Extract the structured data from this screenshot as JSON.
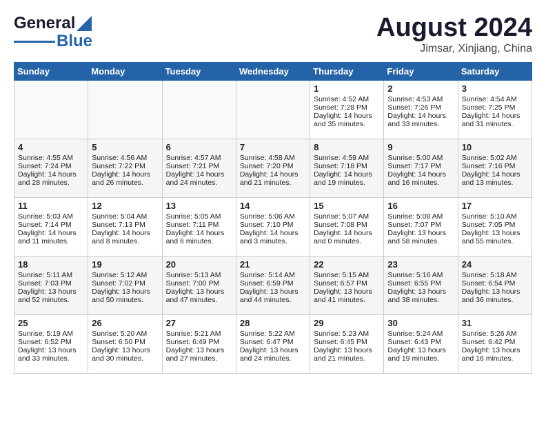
{
  "header": {
    "logo_line1": "General",
    "logo_line2": "Blue",
    "month_year": "August 2024",
    "location": "Jimsar, Xinjiang, China"
  },
  "days_of_week": [
    "Sunday",
    "Monday",
    "Tuesday",
    "Wednesday",
    "Thursday",
    "Friday",
    "Saturday"
  ],
  "weeks": [
    [
      {
        "day": "",
        "content": ""
      },
      {
        "day": "",
        "content": ""
      },
      {
        "day": "",
        "content": ""
      },
      {
        "day": "",
        "content": ""
      },
      {
        "day": "1",
        "content": "Sunrise: 4:52 AM\nSunset: 7:28 PM\nDaylight: 14 hours\nand 35 minutes."
      },
      {
        "day": "2",
        "content": "Sunrise: 4:53 AM\nSunset: 7:26 PM\nDaylight: 14 hours\nand 33 minutes."
      },
      {
        "day": "3",
        "content": "Sunrise: 4:54 AM\nSunset: 7:25 PM\nDaylight: 14 hours\nand 31 minutes."
      }
    ],
    [
      {
        "day": "4",
        "content": "Sunrise: 4:55 AM\nSunset: 7:24 PM\nDaylight: 14 hours\nand 28 minutes."
      },
      {
        "day": "5",
        "content": "Sunrise: 4:56 AM\nSunset: 7:22 PM\nDaylight: 14 hours\nand 26 minutes."
      },
      {
        "day": "6",
        "content": "Sunrise: 4:57 AM\nSunset: 7:21 PM\nDaylight: 14 hours\nand 24 minutes."
      },
      {
        "day": "7",
        "content": "Sunrise: 4:58 AM\nSunset: 7:20 PM\nDaylight: 14 hours\nand 21 minutes."
      },
      {
        "day": "8",
        "content": "Sunrise: 4:59 AM\nSunset: 7:18 PM\nDaylight: 14 hours\nand 19 minutes."
      },
      {
        "day": "9",
        "content": "Sunrise: 5:00 AM\nSunset: 7:17 PM\nDaylight: 14 hours\nand 16 minutes."
      },
      {
        "day": "10",
        "content": "Sunrise: 5:02 AM\nSunset: 7:16 PM\nDaylight: 14 hours\nand 13 minutes."
      }
    ],
    [
      {
        "day": "11",
        "content": "Sunrise: 5:03 AM\nSunset: 7:14 PM\nDaylight: 14 hours\nand 11 minutes."
      },
      {
        "day": "12",
        "content": "Sunrise: 5:04 AM\nSunset: 7:13 PM\nDaylight: 14 hours\nand 8 minutes."
      },
      {
        "day": "13",
        "content": "Sunrise: 5:05 AM\nSunset: 7:11 PM\nDaylight: 14 hours\nand 6 minutes."
      },
      {
        "day": "14",
        "content": "Sunrise: 5:06 AM\nSunset: 7:10 PM\nDaylight: 14 hours\nand 3 minutes."
      },
      {
        "day": "15",
        "content": "Sunrise: 5:07 AM\nSunset: 7:08 PM\nDaylight: 14 hours\nand 0 minutes."
      },
      {
        "day": "16",
        "content": "Sunrise: 5:08 AM\nSunset: 7:07 PM\nDaylight: 13 hours\nand 58 minutes."
      },
      {
        "day": "17",
        "content": "Sunrise: 5:10 AM\nSunset: 7:05 PM\nDaylight: 13 hours\nand 55 minutes."
      }
    ],
    [
      {
        "day": "18",
        "content": "Sunrise: 5:11 AM\nSunset: 7:03 PM\nDaylight: 13 hours\nand 52 minutes."
      },
      {
        "day": "19",
        "content": "Sunrise: 5:12 AM\nSunset: 7:02 PM\nDaylight: 13 hours\nand 50 minutes."
      },
      {
        "day": "20",
        "content": "Sunrise: 5:13 AM\nSunset: 7:00 PM\nDaylight: 13 hours\nand 47 minutes."
      },
      {
        "day": "21",
        "content": "Sunrise: 5:14 AM\nSunset: 6:59 PM\nDaylight: 13 hours\nand 44 minutes."
      },
      {
        "day": "22",
        "content": "Sunrise: 5:15 AM\nSunset: 6:57 PM\nDaylight: 13 hours\nand 41 minutes."
      },
      {
        "day": "23",
        "content": "Sunrise: 5:16 AM\nSunset: 6:55 PM\nDaylight: 13 hours\nand 38 minutes."
      },
      {
        "day": "24",
        "content": "Sunrise: 5:18 AM\nSunset: 6:54 PM\nDaylight: 13 hours\nand 36 minutes."
      }
    ],
    [
      {
        "day": "25",
        "content": "Sunrise: 5:19 AM\nSunset: 6:52 PM\nDaylight: 13 hours\nand 33 minutes."
      },
      {
        "day": "26",
        "content": "Sunrise: 5:20 AM\nSunset: 6:50 PM\nDaylight: 13 hours\nand 30 minutes."
      },
      {
        "day": "27",
        "content": "Sunrise: 5:21 AM\nSunset: 6:49 PM\nDaylight: 13 hours\nand 27 minutes."
      },
      {
        "day": "28",
        "content": "Sunrise: 5:22 AM\nSunset: 6:47 PM\nDaylight: 13 hours\nand 24 minutes."
      },
      {
        "day": "29",
        "content": "Sunrise: 5:23 AM\nSunset: 6:45 PM\nDaylight: 13 hours\nand 21 minutes."
      },
      {
        "day": "30",
        "content": "Sunrise: 5:24 AM\nSunset: 6:43 PM\nDaylight: 13 hours\nand 19 minutes."
      },
      {
        "day": "31",
        "content": "Sunrise: 5:26 AM\nSunset: 6:42 PM\nDaylight: 13 hours\nand 16 minutes."
      }
    ]
  ]
}
